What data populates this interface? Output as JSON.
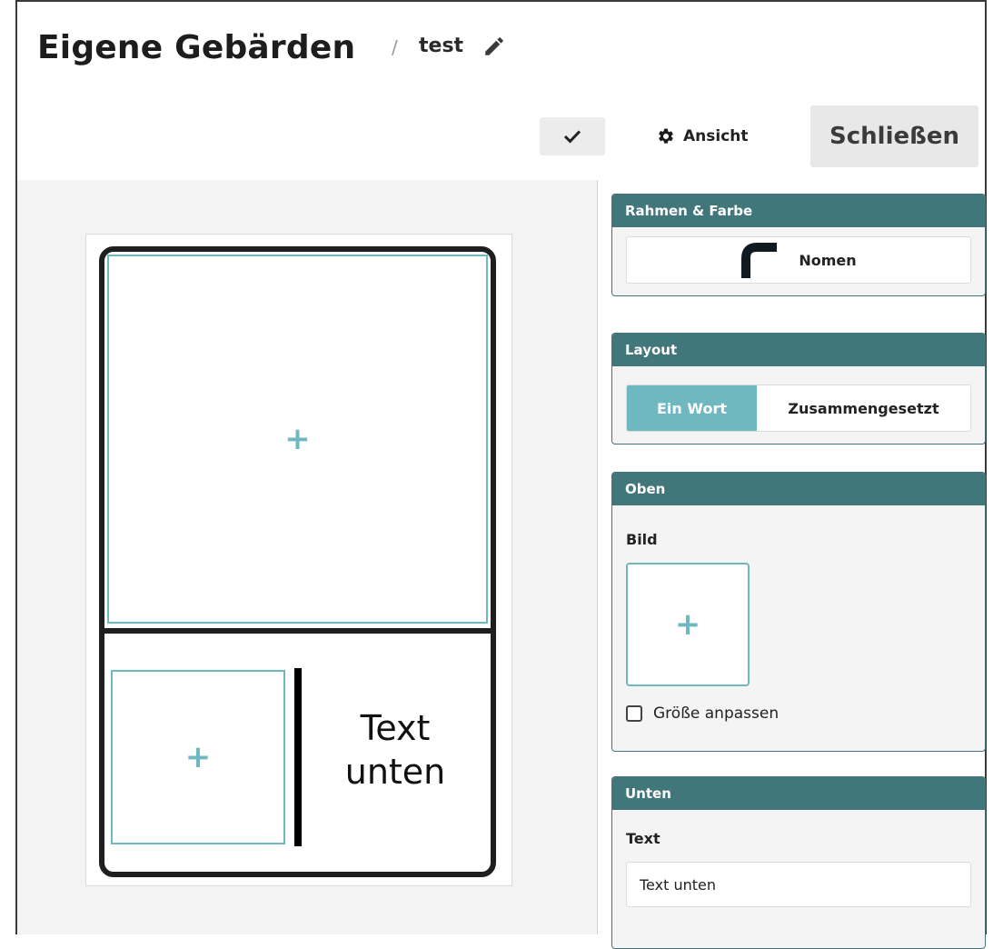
{
  "header": {
    "title": "Eigene Gebärden",
    "crumb_sep": "/",
    "crumb": "test",
    "edit_icon": "pencil-icon",
    "check_icon": "checkmark-icon",
    "view_label": "Ansicht",
    "view_icon": "gear-icon",
    "close_label": "Schließen"
  },
  "card": {
    "top_add": "+",
    "bottom_add": "+",
    "bottom_text": "Text unten"
  },
  "panel": {
    "frame": {
      "title": "Rahmen & Farbe",
      "button_label": "Nomen",
      "icon": "frame-corner-icon"
    },
    "layout": {
      "title": "Layout",
      "options": [
        "Ein Wort",
        "Zusammengesetzt"
      ],
      "selected": "Ein Wort"
    },
    "top": {
      "title": "Oben",
      "image_label": "Bild",
      "image_add": "+",
      "resize_label": "Größe anpassen",
      "resize_checked": false
    },
    "bottom": {
      "title": "Unten",
      "text_label": "Text",
      "text_value": "Text unten"
    }
  },
  "colors": {
    "accent": "#6fb8c0",
    "panel_header": "#41767b"
  }
}
